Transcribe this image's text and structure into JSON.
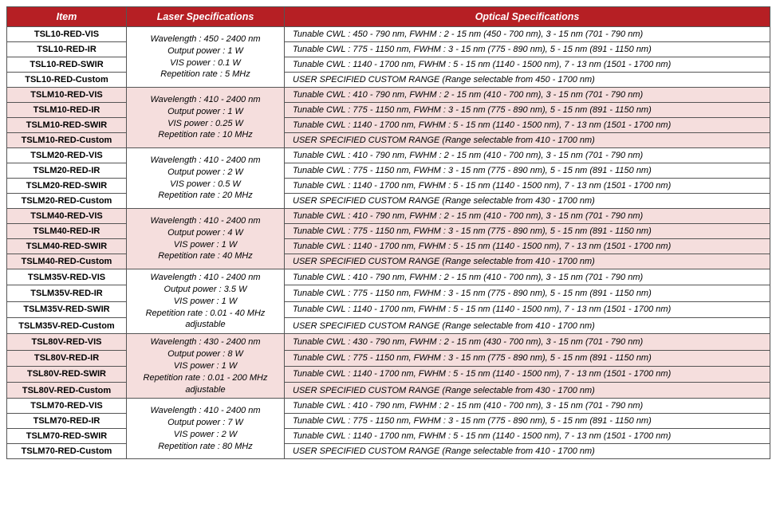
{
  "headers": {
    "item": "Item",
    "laser": "Laser Specifications",
    "optical": "Optical Specifications"
  },
  "groups": [
    {
      "tint": false,
      "laser": "Wavelength : 450 - 2400 nm\nOutput power : 1 W\nVIS power : 0.1 W\nRepetition rate : 5 MHz",
      "rows": [
        {
          "item": "TSL10-RED-VIS",
          "opt": "Tunable CWL : 450 - 790 nm, FWHM : 2 - 15 nm (450 - 700 nm), 3 - 15 nm (701 - 790 nm)"
        },
        {
          "item": "TSL10-RED-IR",
          "opt": "Tunable CWL : 775 - 1150 nm, FWHM : 3 - 15 nm (775 - 890 nm), 5 - 15 nm (891 - 1150 nm)"
        },
        {
          "item": "TSL10-RED-SWIR",
          "opt": "Tunable CWL : 1140 - 1700 nm, FWHM : 5 - 15 nm (1140 - 1500 nm), 7 - 13 nm (1501 - 1700 nm)"
        },
        {
          "item": "TSL10-RED-Custom",
          "opt": "USER SPECIFIED CUSTOM RANGE (Range selectable from 450 - 1700 nm)"
        }
      ]
    },
    {
      "tint": true,
      "laser": "Wavelength : 410 - 2400 nm\nOutput power : 1 W\nVIS power : 0.25 W\nRepetition rate : 10 MHz",
      "rows": [
        {
          "item": "TSLM10-RED-VIS",
          "opt": "Tunable CWL : 410 - 790 nm, FWHM : 2 - 15 nm (410 - 700 nm), 3 - 15 nm (701 - 790 nm)"
        },
        {
          "item": "TSLM10-RED-IR",
          "opt": "Tunable CWL : 775 - 1150 nm, FWHM : 3 - 15 nm (775 - 890 nm), 5 - 15 nm (891 - 1150 nm)"
        },
        {
          "item": "TSLM10-RED-SWIR",
          "opt": "Tunable CWL : 1140 - 1700 nm, FWHM : 5 - 15 nm (1140 - 1500 nm), 7 - 13 nm (1501 - 1700 nm)"
        },
        {
          "item": "TSLM10-RED-Custom",
          "opt": "USER SPECIFIED CUSTOM RANGE (Range selectable from 410 - 1700 nm)"
        }
      ]
    },
    {
      "tint": false,
      "laser": "Wavelength : 410 - 2400 nm\nOutput power : 2 W\nVIS power : 0.5 W\nRepetition rate : 20 MHz",
      "rows": [
        {
          "item": "TSLM20-RED-VIS",
          "opt": "Tunable CWL : 410 - 790 nm, FWHM : 2 - 15 nm (410 - 700 nm), 3 - 15 nm (701 - 790 nm)"
        },
        {
          "item": "TSLM20-RED-IR",
          "opt": "Tunable CWL : 775 - 1150 nm, FWHM : 3 - 15 nm (775 - 890 nm), 5 - 15 nm (891 - 1150 nm)"
        },
        {
          "item": "TSLM20-RED-SWIR",
          "opt": "Tunable CWL : 1140 - 1700 nm, FWHM : 5 - 15 nm (1140 - 1500 nm), 7 - 13 nm (1501 - 1700 nm)"
        },
        {
          "item": "TSLM20-RED-Custom",
          "opt": "USER SPECIFIED CUSTOM RANGE (Range selectable from 430 - 1700 nm)"
        }
      ]
    },
    {
      "tint": true,
      "laser": "Wavelength : 410 - 2400 nm\nOutput power : 4 W\nVIS power : 1 W\nRepetition rate : 40 MHz",
      "rows": [
        {
          "item": "TSLM40-RED-VIS",
          "opt": "Tunable CWL : 410 - 790 nm, FWHM : 2 - 15 nm (410 - 700 nm), 3 - 15 nm (701 - 790 nm)"
        },
        {
          "item": "TSLM40-RED-IR",
          "opt": "Tunable CWL : 775 - 1150 nm, FWHM : 3 - 15 nm (775 - 890 nm), 5 - 15 nm (891 - 1150 nm)"
        },
        {
          "item": "TSLM40-RED-SWIR",
          "opt": "Tunable CWL : 1140 - 1700 nm, FWHM : 5 - 15 nm (1140 - 1500 nm), 7 - 13 nm (1501 - 1700 nm)"
        },
        {
          "item": "TSLM40-RED-Custom",
          "opt": "USER SPECIFIED CUSTOM RANGE (Range selectable from 410 - 1700 nm)"
        }
      ]
    },
    {
      "tint": false,
      "laser": "Wavelength : 410 - 2400 nm\nOutput power : 3.5 W\nVIS power : 1 W\nRepetition rate : 0.01 - 40 MHz\nadjustable",
      "rows": [
        {
          "item": "TSLM35V-RED-VIS",
          "opt": "Tunable CWL : 410 - 790 nm, FWHM : 2 - 15 nm (410 - 700 nm), 3 - 15 nm (701 - 790 nm)"
        },
        {
          "item": "TSLM35V-RED-IR",
          "opt": "Tunable CWL : 775 - 1150 nm, FWHM : 3 - 15 nm (775 - 890 nm), 5 - 15 nm (891 - 1150 nm)"
        },
        {
          "item": "TSLM35V-RED-SWIR",
          "opt": "Tunable CWL : 1140 - 1700 nm, FWHM : 5 - 15 nm (1140 - 1500 nm), 7 - 13 nm (1501 - 1700 nm)"
        },
        {
          "item": "TSLM35V-RED-Custom",
          "opt": "USER SPECIFIED CUSTOM RANGE (Range selectable from 410 - 1700 nm)"
        }
      ]
    },
    {
      "tint": true,
      "laser": "Wavelength : 430 - 2400 nm\nOutput power : 8 W\nVIS power : 1 W\nRepetition rate : 0.01 - 200 MHz\nadjustable",
      "rows": [
        {
          "item": "TSL80V-RED-VIS",
          "opt": "Tunable CWL : 430 - 790 nm, FWHM : 2 - 15 nm (430 - 700 nm), 3 - 15 nm (701 - 790 nm)"
        },
        {
          "item": "TSL80V-RED-IR",
          "opt": "Tunable CWL : 775 - 1150 nm, FWHM : 3 - 15 nm (775 - 890 nm), 5 - 15 nm (891 - 1150 nm)"
        },
        {
          "item": "TSL80V-RED-SWIR",
          "opt": "Tunable CWL : 1140 - 1700 nm, FWHM : 5 - 15 nm (1140 - 1500 nm), 7 - 13 nm (1501 - 1700 nm)"
        },
        {
          "item": "TSL80V-RED-Custom",
          "opt": "USER SPECIFIED CUSTOM RANGE (Range selectable from 430 - 1700 nm)"
        }
      ]
    },
    {
      "tint": false,
      "laser": "Wavelength : 410 - 2400 nm\nOutput power : 7 W\nVIS power : 2 W\nRepetition rate : 80 MHz",
      "rows": [
        {
          "item": "TSLM70-RED-VIS",
          "opt": "Tunable CWL : 410 - 790 nm, FWHM : 2 - 15 nm (410 - 700 nm), 3 - 15 nm (701 - 790 nm)"
        },
        {
          "item": "TSLM70-RED-IR",
          "opt": "Tunable CWL : 775 - 1150 nm, FWHM : 3 - 15 nm (775 - 890 nm), 5 - 15 nm (891 - 1150 nm)"
        },
        {
          "item": "TSLM70-RED-SWIR",
          "opt": "Tunable CWL : 1140 - 1700 nm, FWHM : 5 - 15 nm (1140 - 1500 nm), 7 - 13 nm (1501 - 1700 nm)"
        },
        {
          "item": "TSLM70-RED-Custom",
          "opt": "USER SPECIFIED CUSTOM RANGE (Range selectable from 410 - 1700 nm)"
        }
      ]
    }
  ]
}
